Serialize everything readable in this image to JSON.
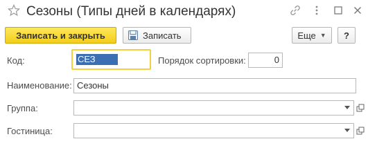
{
  "window": {
    "title": "Сезоны (Типы дней в календарях)"
  },
  "toolbar": {
    "save_close_label": "Записать и закрыть",
    "save_label": "Записать",
    "more_label": "Еще",
    "help_label": "?"
  },
  "form": {
    "code": {
      "label": "Код:",
      "value": "СЕЗ"
    },
    "sort_order": {
      "label": "Порядок сортировки:",
      "value": "0"
    },
    "name": {
      "label": "Наименование:",
      "value": "Сезоны"
    },
    "group": {
      "label": "Группа:",
      "value": ""
    },
    "hotel": {
      "label": "Гостиница:",
      "value": ""
    }
  },
  "icons": [
    "star-icon",
    "link-icon",
    "more-vert-icon",
    "maximize-icon",
    "close-icon",
    "save-disk-icon",
    "dropdown-arrow-icon",
    "open-link-icon"
  ],
  "colors": {
    "primary_button": "#f6d22e",
    "focus_border": "#f6cf3f",
    "selection": "#3c6eb4"
  }
}
